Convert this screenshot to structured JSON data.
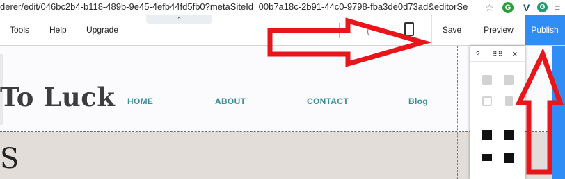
{
  "browser": {
    "url": "derer/edit/046bc2b4-b118-489b-9e45-4efb44fd5fb0?metaSiteId=00b7a18c-2b91-44c0-9798-fba3de0d73ad&editorSe",
    "icons": [
      "star-icon",
      "extension-g-icon",
      "vimeo-icon",
      "grammarly-icon",
      "menu-icon"
    ]
  },
  "editor_menu": {
    "tools": "Tools",
    "help": "Help",
    "upgrade": "Upgrade"
  },
  "toolbar": {
    "save": "Save",
    "preview": "Preview",
    "publish": "Publish",
    "handle": "⌃"
  },
  "site": {
    "title": "To Luck",
    "nav": [
      "HOME",
      "ABOUT",
      "CONTACT",
      "Blog"
    ],
    "section_char": "S"
  },
  "arrange_panel": {
    "help": "?",
    "close": "×"
  },
  "colors": {
    "accent": "#2f8df5",
    "arrow": "#e8161b",
    "nav": "#3a8f95"
  }
}
